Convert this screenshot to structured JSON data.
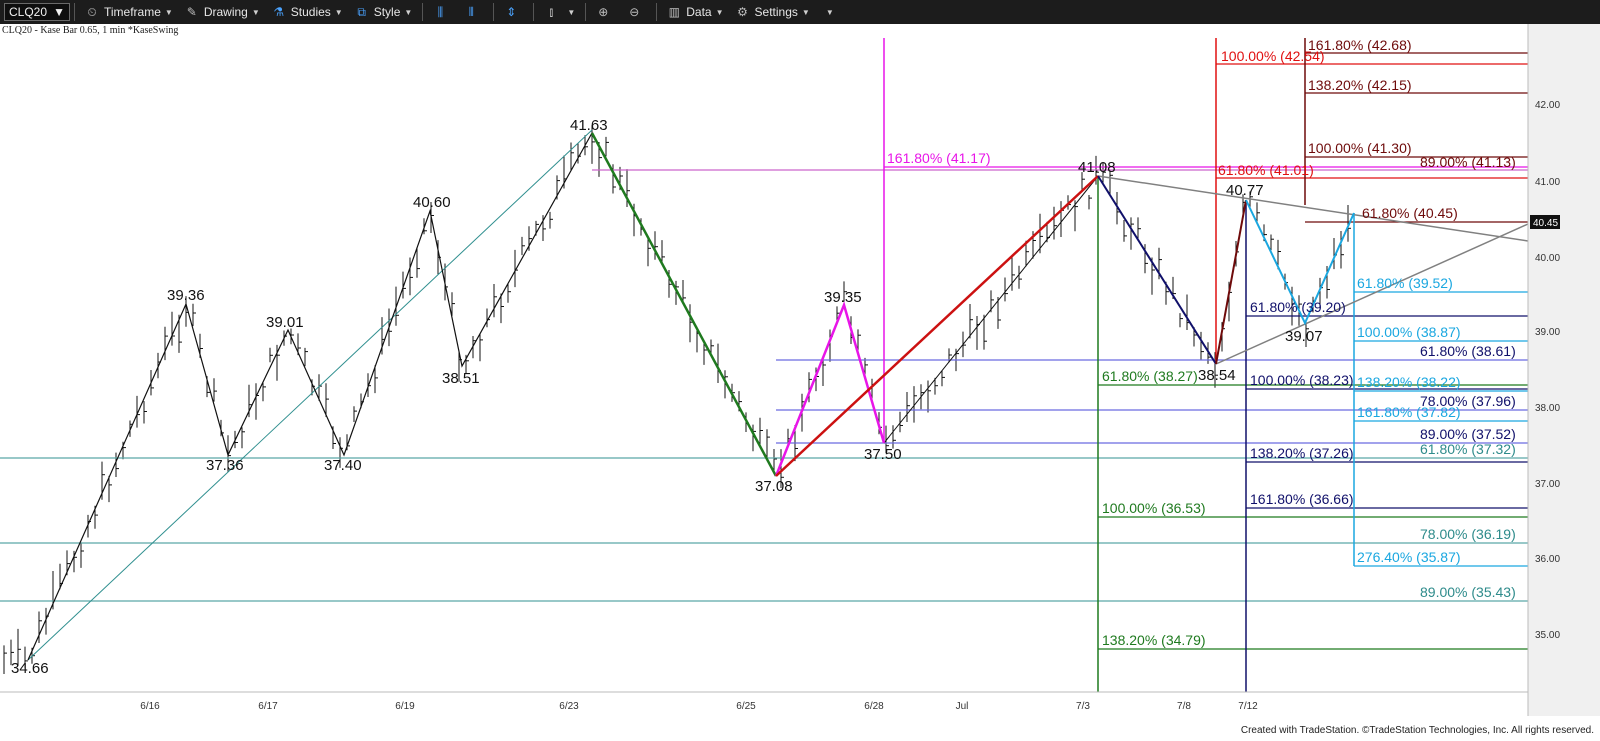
{
  "toolbar": {
    "symbol": "CLQ20",
    "timeframe_label": "Timeframe",
    "drawing_label": "Drawing",
    "studies_label": "Studies",
    "style_label": "Style",
    "data_label": "Data",
    "settings_label": "Settings"
  },
  "chart_caption": "CLQ20 - Kase Bar 0.65, 1 min  *KaseSwing",
  "footer": "Created with TradeStation. ©TradeStation Technologies, Inc. All rights reserved.",
  "colors": {
    "magenta": "#e815e8",
    "green": "#1f7a1f",
    "red": "#e01010",
    "maroon": "#6e0a0a",
    "navy": "#10106a",
    "cyan": "#1aa7e0",
    "teal": "#5aa8a8",
    "periwinkle": "#6a6ae0",
    "gray": "#808080"
  },
  "chart_data": {
    "type": "bar",
    "y_ticks": [
      "42.00",
      "41.00",
      "40.00",
      "39.00",
      "38.00",
      "37.00",
      "36.00",
      "35.00"
    ],
    "x_ticks": [
      "6/16",
      "6/17",
      "6/19",
      "6/23",
      "6/25",
      "6/28",
      "Jul",
      "7/3",
      "7/8",
      "7/12"
    ],
    "last_price": "40.45",
    "swing_labels": [
      {
        "id": "a",
        "text": "34.66"
      },
      {
        "id": "b",
        "text": "39.36"
      },
      {
        "id": "c",
        "text": "37.36"
      },
      {
        "id": "d",
        "text": "39.01"
      },
      {
        "id": "e",
        "text": "37.40"
      },
      {
        "id": "f",
        "text": "40.60"
      },
      {
        "id": "g",
        "text": "38.51"
      },
      {
        "id": "h",
        "text": "41.63"
      },
      {
        "id": "i",
        "text": "37.08"
      },
      {
        "id": "j",
        "text": "39.35"
      },
      {
        "id": "k",
        "text": "37.50"
      },
      {
        "id": "l",
        "text": "41.08"
      },
      {
        "id": "m",
        "text": "38.54"
      },
      {
        "id": "n",
        "text": "40.77"
      },
      {
        "id": "o",
        "text": "39.07"
      }
    ],
    "fib_labels": [
      {
        "id": "f1",
        "text": "161.80% (41.17)",
        "color": "#e815e8"
      },
      {
        "id": "f2",
        "text": "100.00% (42.54)",
        "color": "#e01010"
      },
      {
        "id": "f3",
        "text": "61.80% (41.01)",
        "color": "#e01010"
      },
      {
        "id": "f4",
        "text": "161.80% (42.68)",
        "color": "#6e0a0a"
      },
      {
        "id": "f5",
        "text": "138.20% (42.15)",
        "color": "#6e0a0a"
      },
      {
        "id": "f6",
        "text": "100.00% (41.30)",
        "color": "#6e0a0a"
      },
      {
        "id": "f7",
        "text": "89.00% (41.13)",
        "color": "#6e0a0a"
      },
      {
        "id": "f8",
        "text": "61.80% (40.45)",
        "color": "#6e0a0a"
      },
      {
        "id": "f9",
        "text": "61.80% (39.52)",
        "color": "#1aa7e0"
      },
      {
        "id": "f10",
        "text": "100.00% (38.87)",
        "color": "#1aa7e0"
      },
      {
        "id": "f11",
        "text": "138.20% (38.22)",
        "color": "#1aa7e0"
      },
      {
        "id": "f12",
        "text": "161.80% (37.82)",
        "color": "#1aa7e0"
      },
      {
        "id": "f13",
        "text": "276.40% (35.87)",
        "color": "#1aa7e0"
      },
      {
        "id": "f14",
        "text": "61.80% (39.20)",
        "color": "#10106a"
      },
      {
        "id": "f15",
        "text": "100.00% (38.23)",
        "color": "#10106a"
      },
      {
        "id": "f16",
        "text": "138.20% (37.26)",
        "color": "#10106a"
      },
      {
        "id": "f17",
        "text": "161.80% (36.66)",
        "color": "#10106a"
      },
      {
        "id": "f18",
        "text": "61.80% (38.61)",
        "color": "#10106a"
      },
      {
        "id": "f19",
        "text": "78.00% (37.96)",
        "color": "#10106a"
      },
      {
        "id": "f20",
        "text": "89.00% (37.52)",
        "color": "#10106a"
      },
      {
        "id": "f21",
        "text": "61.80% (37.32)",
        "color": "#2e8b8b"
      },
      {
        "id": "f22",
        "text": "78.00% (36.19)",
        "color": "#2e8b8b"
      },
      {
        "id": "f23",
        "text": "89.00% (35.43)",
        "color": "#2e8b8b"
      },
      {
        "id": "f24",
        "text": "61.80% (38.27)",
        "color": "#1f7a1f"
      },
      {
        "id": "f25",
        "text": "100.00% (36.53)",
        "color": "#1f7a1f"
      },
      {
        "id": "f26",
        "text": "138.20% (34.79)",
        "color": "#1f7a1f"
      }
    ]
  }
}
